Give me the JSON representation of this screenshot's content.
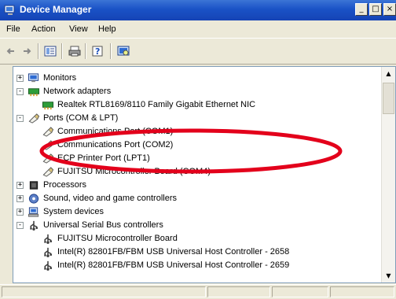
{
  "window": {
    "title": "Device Manager"
  },
  "menu": [
    {
      "label": "File"
    },
    {
      "label": "Action"
    },
    {
      "label": "View"
    },
    {
      "label": "Help"
    }
  ],
  "window_buttons": [
    "_",
    "□",
    "×"
  ],
  "tree": [
    {
      "label": "Monitors",
      "icon": "monitor-icon",
      "expander": "+"
    },
    {
      "label": "Network adapters",
      "icon": "network-adapter-icon",
      "expander": "-"
    },
    {
      "label": "Realtek RTL8169/8110 Family Gigabit Ethernet NIC",
      "icon": "network-card-icon"
    },
    {
      "label": "Ports (COM & LPT)",
      "icon": "port-connector-icon",
      "expander": "-"
    },
    {
      "label": "Communications Port (COM1)",
      "icon": "port-connector-icon"
    },
    {
      "label": "Communications Port (COM2)",
      "icon": "port-connector-icon"
    },
    {
      "label": "ECP Printer Port (LPT1)",
      "icon": "port-connector-icon"
    },
    {
      "label": "FUJITSU Microcontroller Board (COM4)",
      "icon": "port-connector-icon"
    },
    {
      "label": "Processors",
      "icon": "processor-icon",
      "expander": "+"
    },
    {
      "label": "Sound, video and game controllers",
      "icon": "sound-icon",
      "expander": "+"
    },
    {
      "label": "System devices",
      "icon": "computer-icon",
      "expander": "+"
    },
    {
      "label": "Universal Serial Bus controllers",
      "icon": "usb-icon",
      "expander": "-"
    },
    {
      "label": "FUJITSU Microcontroller Board",
      "icon": "usb-icon"
    },
    {
      "label": "Intel(R) 82801FB/FBM USB Universal Host Controller - 2658",
      "icon": "usb-icon"
    },
    {
      "label": "Intel(R) 82801FB/FBM USB Universal Host Controller - 2659",
      "icon": "usb-icon"
    }
  ],
  "colors": {
    "titlebar": "#1a52c6",
    "highlight": "#e3001b"
  }
}
